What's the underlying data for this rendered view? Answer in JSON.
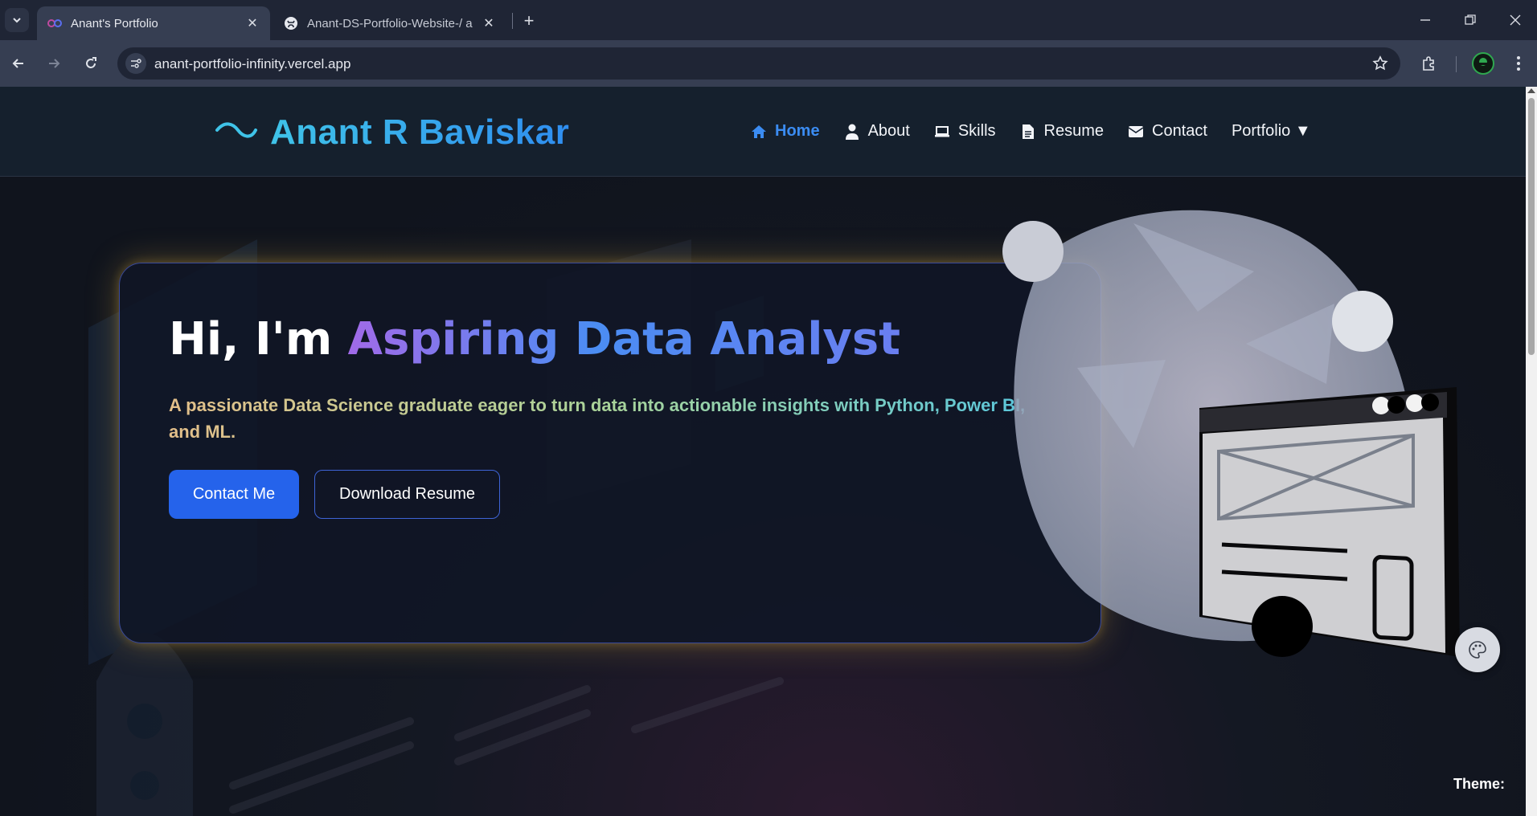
{
  "browser": {
    "tabs": [
      {
        "title": "Anant's Portfolio",
        "active": true
      },
      {
        "title": "Anant-DS-Portfolio-Website-/ a",
        "active": false
      }
    ],
    "url": "anant-portfolio-infinity.vercel.app"
  },
  "site": {
    "logo": "Anant R Baviskar",
    "nav": [
      {
        "label": "Home",
        "icon": "home-icon"
      },
      {
        "label": "About",
        "icon": "user-icon"
      },
      {
        "label": "Skills",
        "icon": "laptop-icon"
      },
      {
        "label": "Resume",
        "icon": "file-icon"
      },
      {
        "label": "Contact",
        "icon": "envelope-icon"
      },
      {
        "label": "Portfolio ▼",
        "icon": ""
      }
    ]
  },
  "hero": {
    "greeting": "Hi, I'm ",
    "role": "Aspiring Data Analyst",
    "subtitle": "A passionate Data Science graduate eager to turn data into actionable insights with Python, Power BI, and ML.",
    "contact_button": "Contact Me",
    "resume_button": "Download Resume"
  },
  "theme": {
    "label": "Theme:"
  },
  "colors": {
    "accent_blue": "#2563eb",
    "nav_active": "#3b8cf2",
    "logo": "#3fc3e8",
    "glow": "#d6a83c"
  }
}
